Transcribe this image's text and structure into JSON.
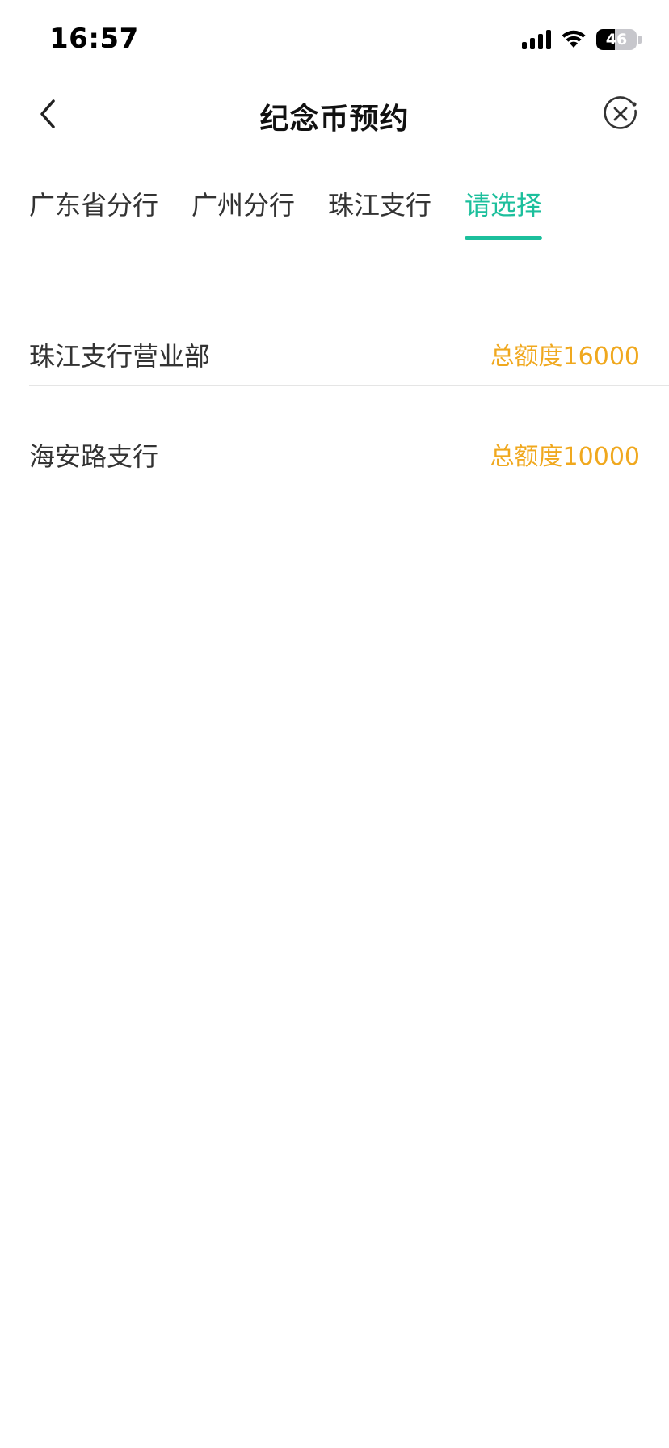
{
  "status_bar": {
    "time": "16:57",
    "battery_level": "46",
    "battery_fraction": 0.46,
    "icons": [
      "signal-icon",
      "wifi-icon",
      "battery-icon"
    ]
  },
  "nav": {
    "title": "纪念币预约",
    "back_icon": "chevron-left-icon",
    "close_icon": "close-circle-icon"
  },
  "tabs": [
    {
      "label": "广东省分行",
      "active": false
    },
    {
      "label": "广州分行",
      "active": false
    },
    {
      "label": "珠江支行",
      "active": false
    },
    {
      "label": "请选择",
      "active": true
    }
  ],
  "branches": [
    {
      "name": "珠江支行营业部",
      "quota": "总额度16000"
    },
    {
      "name": "海安路支行",
      "quota": "总额度10000"
    }
  ],
  "colors": {
    "accent": "#1cbf9c",
    "quota": "#f0a81e",
    "text": "#333333",
    "divider": "#e5e5e5"
  }
}
